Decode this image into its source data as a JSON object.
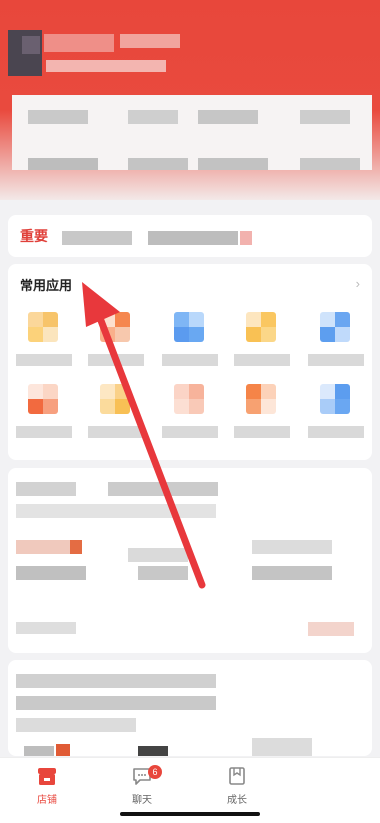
{
  "important_card": {
    "label": "重要"
  },
  "common_apps": {
    "title": "常用应用",
    "chevron": "›"
  },
  "tabbar": {
    "tabs": [
      {
        "label": "店铺",
        "icon": "store-icon",
        "active": true
      },
      {
        "label": "聊天",
        "icon": "chat-icon",
        "active": false,
        "badge": "6"
      },
      {
        "label": "成长",
        "icon": "growth-icon",
        "active": false
      }
    ]
  },
  "colors": {
    "accent": "#e8463c",
    "arrow": "#e8383c"
  }
}
